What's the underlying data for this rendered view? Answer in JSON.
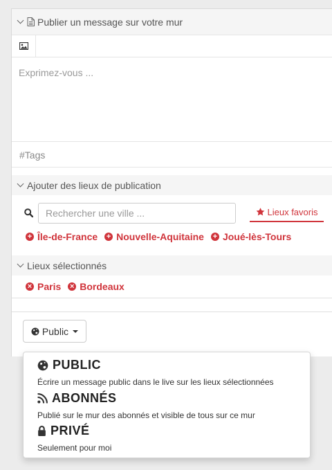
{
  "composer": {
    "title": "Publier un message sur votre mur",
    "message_placeholder": "Exprimez-vous ...",
    "tags_placeholder": "#Tags"
  },
  "places": {
    "add_header": "Ajouter des lieux de publication",
    "search_placeholder": "Rechercher une ville ...",
    "favorites_tab": "Lieux favoris",
    "suggested": [
      "Île-de-France",
      "Nouvelle-Aquitaine",
      "Joué-lès-Tours"
    ],
    "selected_header": "Lieux sélectionnés",
    "selected": [
      "Paris",
      "Bordeaux"
    ]
  },
  "visibility": {
    "button_label": "Public",
    "options": [
      {
        "title": "PUBLIC",
        "icon": "globe-icon",
        "description": "Écrire un message public dans le live sur les lieux sélectionnées"
      },
      {
        "title": "ABONNÉS",
        "icon": "rss-icon",
        "description": "Publié sur le mur des abonnés et visible de tous sur ce mur"
      },
      {
        "title": "PRIVÉ",
        "icon": "lock-icon",
        "description": "Seulement pour moi"
      }
    ]
  },
  "colors": {
    "accent": "#d0343b",
    "background": "#ececec",
    "section_header": "#f5f5f5"
  }
}
